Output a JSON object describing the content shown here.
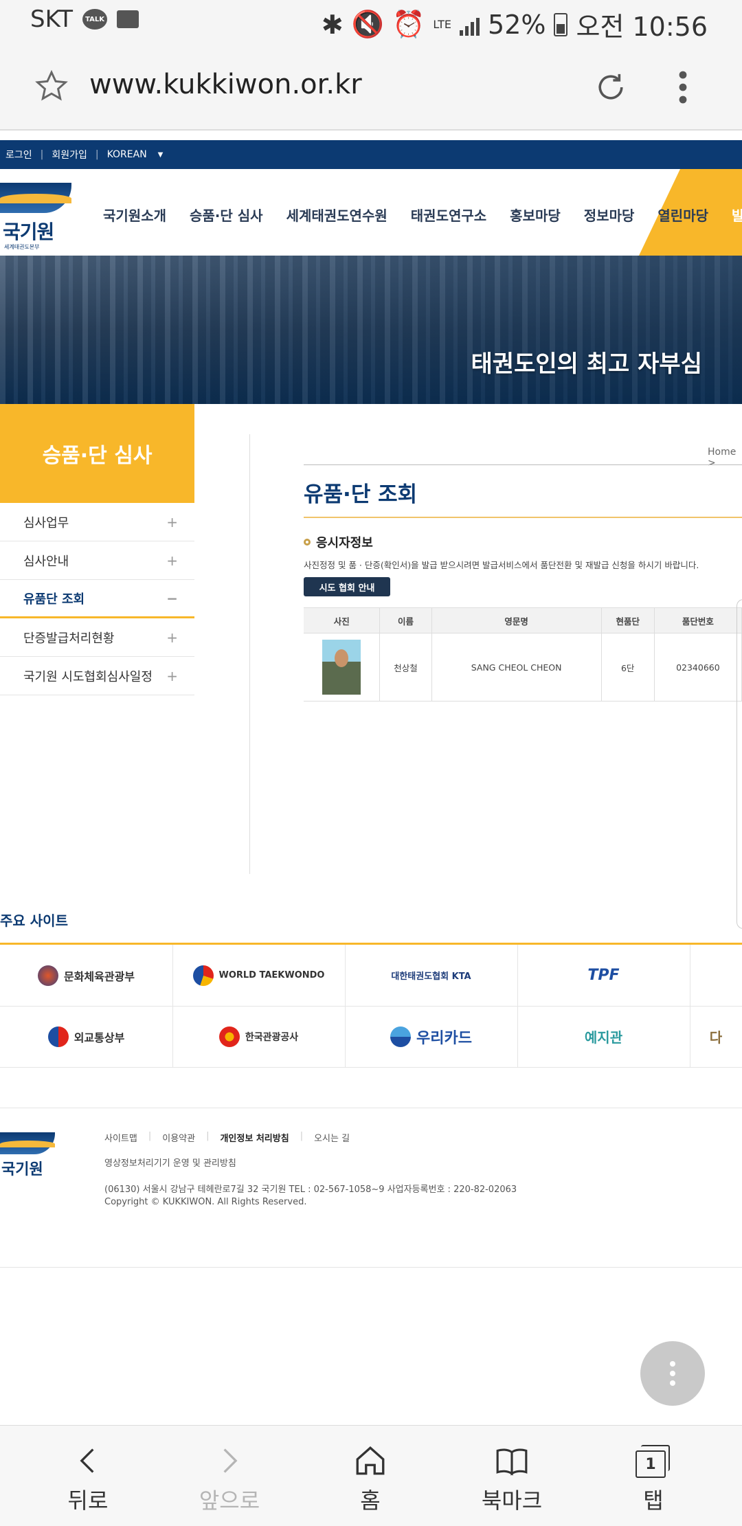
{
  "status_bar": {
    "carrier": "SKT",
    "talk": "TALK",
    "network": "LTE",
    "battery": "52%",
    "time": "오전 10:56"
  },
  "browser": {
    "url": "www.kukkiwon.or.kr"
  },
  "site": {
    "top_links": [
      "로그인",
      "회원가입",
      "KOREAN"
    ],
    "logo_text": "국기원",
    "logo_sub": "세계태권도본부",
    "gnb": [
      "국기원소개",
      "승품·단 심사",
      "세계태권도연수원",
      "태권도연구소",
      "홍보마당",
      "정보마당",
      "열린마당",
      "발급서"
    ],
    "hero_caption": "태권도인의 최고 자부심"
  },
  "sidebar": {
    "title": "승품·단 심사",
    "items": [
      {
        "label": "심사업무",
        "mark": "+"
      },
      {
        "label": "심사안내",
        "mark": "+"
      },
      {
        "label": "유품단 조회",
        "mark": "−"
      },
      {
        "label": "단증발급처리현황",
        "mark": "+"
      },
      {
        "label": "국기원 시도협회심사일정",
        "mark": "+"
      }
    ]
  },
  "content": {
    "breadcrumb": "Home >",
    "title": "유품·단 조회",
    "section_title": "응시자정보",
    "notice": "사진정정 및 품 · 단증(확인서)을 발급 받으시려면 발급서비스에서 품단전환 및 재발급 신청을 하시기 바랍니다.",
    "button": "시도 협회 안내",
    "table": {
      "headers": [
        "사진",
        "이름",
        "영문명",
        "현품단",
        "품단번호"
      ],
      "row": {
        "name": "천상철",
        "english_name": "SANG CHEOL CHEON",
        "rank": "6단",
        "number": "02340660"
      }
    }
  },
  "related": {
    "title": "주요 사이트",
    "sites": [
      "문화체육관광부",
      "WORLD TAEKWONDO",
      "대한태권도협회 KTA",
      "TPF",
      "외교통상부",
      "한국관광공사",
      "우리카드",
      "예지관",
      "다"
    ]
  },
  "footer": {
    "links": [
      "사이트맵",
      "이용약관",
      "개인정보 처리방침",
      "오시는 길"
    ],
    "cctv": "영상정보처리기기 운영 및 관리방침",
    "address": "(06130) 서울시 강남구 테헤란로7길 32 국기원 TEL : 02-567-1058~9 사업자등록번호 : 220-82-02063",
    "copyright": "Copyright © KUKKIWON. All Rights Reserved."
  },
  "bottom_nav": {
    "back": "뒤로",
    "forward": "앞으로",
    "home": "홈",
    "bookmark": "북마크",
    "tabs": "탭",
    "tab_count": "1"
  },
  "colors": {
    "navy": "#0c3a72",
    "accent": "#f8b72a"
  }
}
